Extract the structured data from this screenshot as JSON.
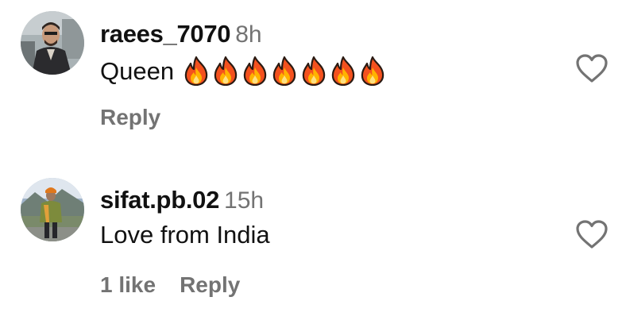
{
  "comments": [
    {
      "username": "raees_7070",
      "time": "8h",
      "text": "Queen",
      "emoji": [
        "fire-emoji",
        "fire-emoji",
        "fire-emoji",
        "fire-emoji",
        "fire-emoji",
        "fire-emoji",
        "fire-emoji"
      ],
      "likes_label": "",
      "reply_label": "Reply"
    },
    {
      "username": "sifat.pb.02",
      "time": "15h",
      "text": "Love from India",
      "emoji": [],
      "likes_label": "1 like",
      "reply_label": "Reply"
    }
  ],
  "icons": {
    "like": "heart-outline-icon",
    "emoji": "fire-emoji"
  },
  "colors": {
    "text": "#111111",
    "secondary": "#737373",
    "background": "#ffffff"
  }
}
